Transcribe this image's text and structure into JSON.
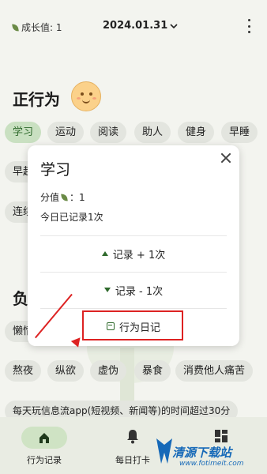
{
  "topbar": {
    "growth_label": "成长值: 1",
    "date": "2024.01.31",
    "date_icon": "chevron-down-icon",
    "menu_icon": "more-vert-icon"
  },
  "positive": {
    "title": "正行为",
    "chips_row1": [
      "学习",
      "运动",
      "阅读",
      "助人",
      "健身",
      "早睡"
    ],
    "chip_row2": "早起",
    "chip_row3": "连续"
  },
  "negative": {
    "title": "负",
    "chip_row1": "懒惰",
    "chips_row2": [
      "熬夜",
      "纵欲",
      "虚伪",
      "暴食",
      "消费他人痛苦"
    ],
    "long_chip": "每天玩信息流app(短视频、新闻等)的时间超过30分"
  },
  "dialog": {
    "title": "学习",
    "score_label": "分值",
    "score_value": "：1",
    "today_label": "今日已记录1次",
    "actions": [
      "记录 + 1次",
      "记录 - 1次",
      "行为日记"
    ]
  },
  "nav": {
    "items": [
      "行为记录",
      "每日打卡",
      ""
    ]
  },
  "watermark": {
    "text": "清源下载站",
    "url": "www.fotimeit.com"
  },
  "colors": {
    "accent": "#2f6a2c",
    "chip_active": "#c9e0c1",
    "highlight": "#dd2222"
  }
}
